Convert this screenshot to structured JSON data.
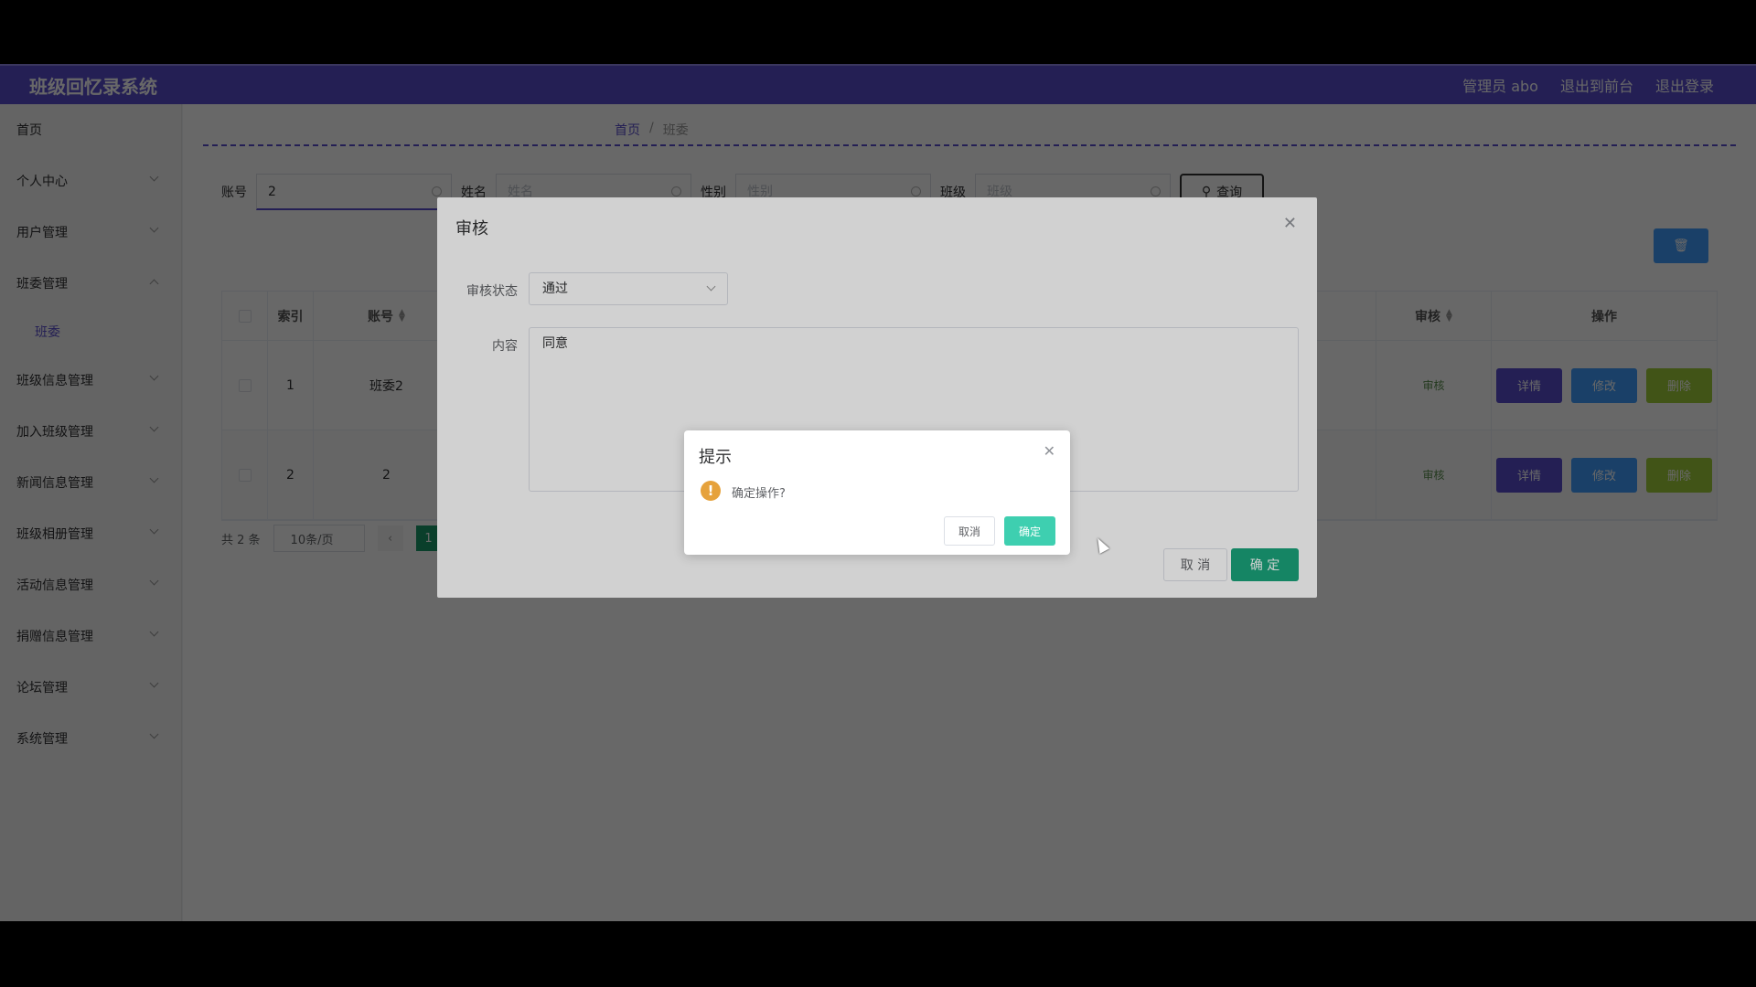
{
  "app": {
    "title": "班级回忆录系统"
  },
  "topbar": {
    "admin": "管理员 abo",
    "to_front": "退出到前台",
    "logout": "退出登录"
  },
  "sidebar": {
    "items": [
      {
        "label": "首页"
      },
      {
        "label": "个人中心"
      },
      {
        "label": "用户管理"
      },
      {
        "label": "班委管理"
      },
      {
        "label": "班级信息管理"
      },
      {
        "label": "加入班级管理"
      },
      {
        "label": "新闻信息管理"
      },
      {
        "label": "班级相册管理"
      },
      {
        "label": "活动信息管理"
      },
      {
        "label": "捐赠信息管理"
      },
      {
        "label": "论坛管理"
      },
      {
        "label": "系统管理"
      }
    ],
    "sub_item": "班委"
  },
  "breadcrumb": {
    "home": "首页",
    "sep": "/",
    "current": "班委"
  },
  "search": {
    "account_label": "账号",
    "account_value": "2",
    "name_label": "姓名",
    "name_placeholder": "姓名",
    "gender_label": "性别",
    "gender_placeholder": "性别",
    "class_label": "班级",
    "class_placeholder": "班级",
    "query_button": "查询"
  },
  "table": {
    "headers": {
      "index": "索引",
      "account": "账号",
      "audit": "审核",
      "ops": "操作"
    },
    "rows": [
      {
        "index": "1",
        "account": "班委2",
        "audit": "审核"
      },
      {
        "index": "2",
        "account": "2",
        "audit": "审核"
      }
    ],
    "op_detail": "详情",
    "op_edit": "修改",
    "op_delete": "删除"
  },
  "pager": {
    "total": "共 2 条",
    "page_size": "10条/页",
    "current": "1"
  },
  "audit_dialog": {
    "title": "审核",
    "status_label": "审核状态",
    "status_value": "通过",
    "content_label": "内容",
    "content_value": "同意",
    "cancel": "取 消",
    "confirm": "确 定"
  },
  "msgbox": {
    "title": "提示",
    "message": "确定操作?",
    "cancel": "取消",
    "confirm": "确定"
  },
  "colors": {
    "brand": "#5b4fcf",
    "confirm_green": "#1aa37a",
    "detail": "#5b4fcf",
    "edit": "#409eff",
    "delete": "#a0cf3b",
    "warning": "#e6a23c"
  }
}
